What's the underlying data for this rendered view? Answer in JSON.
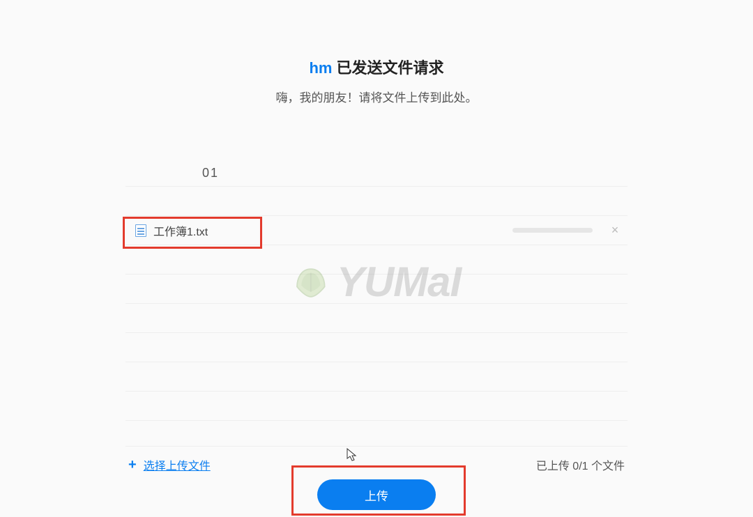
{
  "header": {
    "sender": "hm",
    "title_suffix": "已发送文件请求",
    "subtitle": "嗨，我的朋友！请将文件上传到此处。"
  },
  "step": {
    "number": "01"
  },
  "file": {
    "name": "工作簿1.txt",
    "icon": "text-file-icon",
    "remove_label": "×"
  },
  "footer": {
    "plus_symbol": "+",
    "select_label": "选择上传文件",
    "status_prefix": "已上传 ",
    "status_count": "0/1",
    "status_suffix": " 个文件"
  },
  "upload": {
    "button_label": "上传"
  },
  "watermark": {
    "text": "YUMaI"
  }
}
